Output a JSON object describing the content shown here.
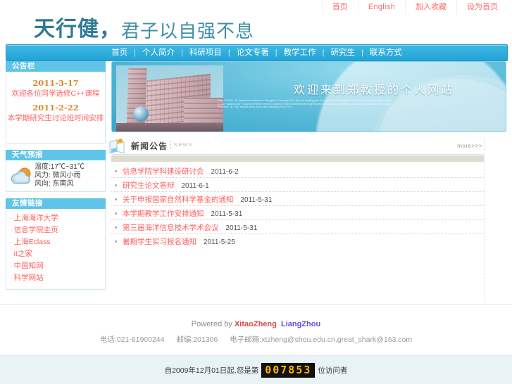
{
  "topbar": {
    "links": [
      {
        "label": "首页",
        "name": "home"
      },
      {
        "label": "English",
        "name": "english"
      },
      {
        "label": "加入收藏",
        "name": "add-favorite"
      },
      {
        "label": "设为首页",
        "name": "set-homepage"
      }
    ]
  },
  "logo": {
    "line1": "天行健，",
    "line2": "君子以自强不息"
  },
  "nav": {
    "items": [
      "首页",
      "个人简介",
      "科研项目",
      "论文专著",
      "教学工作",
      "研究生",
      "联系方式"
    ],
    "separator": "|"
  },
  "sidebar": {
    "notice": {
      "title": "公告栏",
      "entries": [
        {
          "date": "2011-3-17",
          "text": "欢迎各位同学选修C++课程"
        },
        {
          "date": "2011-2-22",
          "text": "本学期研究生讨论班时间安排"
        }
      ]
    },
    "weather": {
      "title": "天气预报",
      "icon": "sun-behind-cloud-icon",
      "temperature": "温度:17℃~31℃",
      "line2": "风力: 微风小雨",
      "line3": "风向: 东南风"
    },
    "links": {
      "title": "友情链接",
      "items": [
        "上海海洋大学",
        "信息学院主页",
        "上海Eclass",
        "it之家",
        "中国知网",
        "科学网站"
      ]
    }
  },
  "banner": {
    "title": "欢迎来到郑教授的个人网站",
    "subtext": "Xitao ZHENG, 60, started his business in Shanghai in February 2011 with the leading post of provost within advanced services for the social middle, chose for the \"quitang tank\" to connect Renke brand for about 20 more workdays with experienced unit biopoles, placements, and course materials. The old and President, Mr. Guy, studied piano theory and rhetorics as his Ph.D.",
    "photo_alt": "campus-building-photo"
  },
  "news": {
    "title": "新闻公告",
    "subtitle": "NEWS",
    "more_label": "more>>>",
    "icon": "news-book-icon",
    "items": [
      {
        "title": "信息学院学科建设研讨会",
        "date": "2011-6-2"
      },
      {
        "title": "研究生论文答辩",
        "date": "2011-6-1"
      },
      {
        "title": "关于申报国家自然科学基金的通知",
        "date": "2011-5-31"
      },
      {
        "title": "本学期教学工作安排通知",
        "date": "2011-5-31"
      },
      {
        "title": "第三届海洋信息技术学术会议",
        "date": "2011-5-31"
      },
      {
        "title": "暑期学生实习报名通知",
        "date": "2011-5-25"
      }
    ]
  },
  "footer": {
    "powered_prefix": "Powered by ",
    "author1": "XitaoZheng",
    "author2": "LiangZhou",
    "phone": "电话:021-61900244",
    "postcode": "邮编:201306",
    "email": "电子邮箱:xtzheng@shou.edu.cn,great_shark@163.com"
  },
  "counter": {
    "prefix": "自2009年12月01日起,您是第",
    "value": "007853",
    "suffix": "位访问者"
  },
  "colors": {
    "nav_blue": "#22a3d6",
    "panel_head_blue": "#5fc4e8",
    "logo_teal": "#2f7a96",
    "link_red": "#ff6060",
    "date_orange": "#d98b2b",
    "lcd_amber": "#ffb400"
  }
}
